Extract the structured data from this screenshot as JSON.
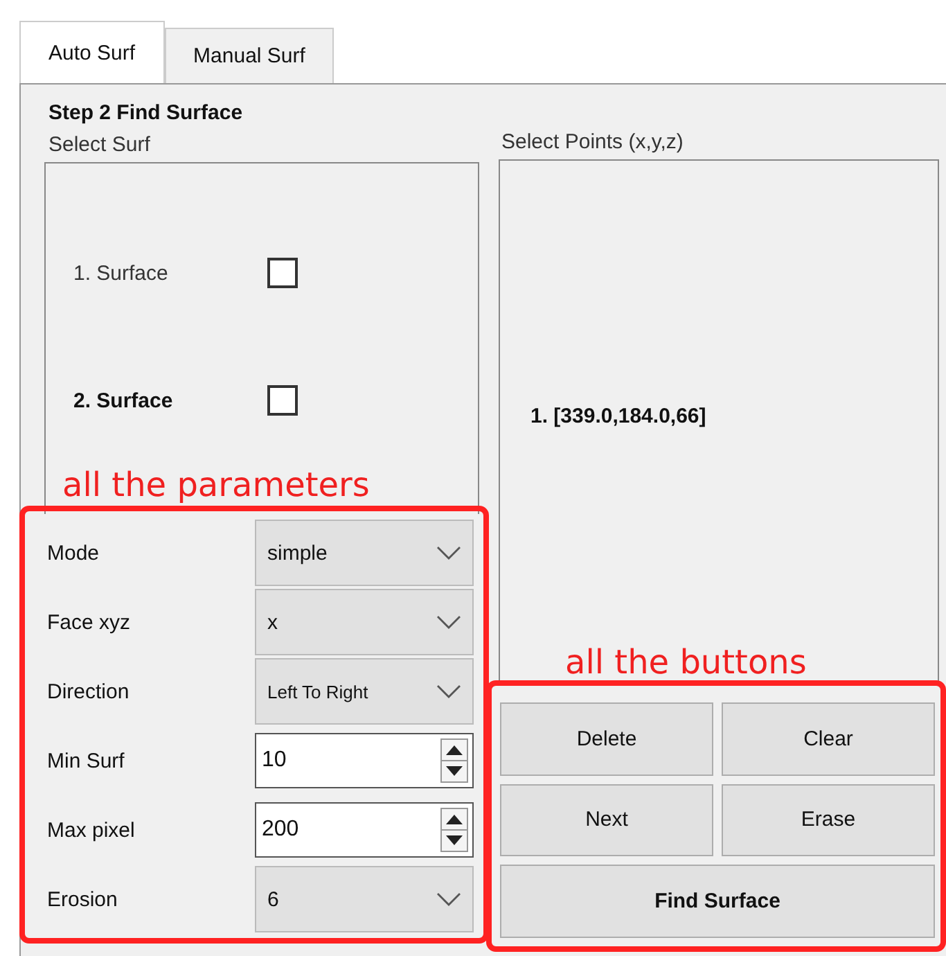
{
  "tabs": [
    {
      "label": "Auto Surf",
      "selected": true
    },
    {
      "label": "Manual Surf",
      "selected": false
    }
  ],
  "step_title": "Step 2 Find Surface",
  "select_surf": {
    "label": "Select Surf",
    "items": [
      {
        "label": "1. Surface",
        "checked": false,
        "bold": false
      },
      {
        "label": "2. Surface",
        "checked": false,
        "bold": true
      }
    ]
  },
  "parameters": [
    {
      "label": "Mode",
      "kind": "dropdown",
      "value": "simple"
    },
    {
      "label": "Face xyz",
      "kind": "dropdown",
      "value": "x"
    },
    {
      "label": "Direction",
      "kind": "dropdown",
      "value": "Left To Right"
    },
    {
      "label": "Min Surf",
      "kind": "spinner",
      "value": "10"
    },
    {
      "label": "Max pixel",
      "kind": "spinner",
      "value": "200"
    },
    {
      "label": "Erosion",
      "kind": "dropdown",
      "value": "6"
    }
  ],
  "points": {
    "label": "Select Points (x,y,z)",
    "items": [
      "1. [339.0,184.0,66]"
    ]
  },
  "buttons": [
    "Delete",
    "Clear",
    "Next",
    "Erase",
    "Find Surface"
  ],
  "parameters_annotation": "all the parameters",
  "buttons_annotation": "all the buttons"
}
